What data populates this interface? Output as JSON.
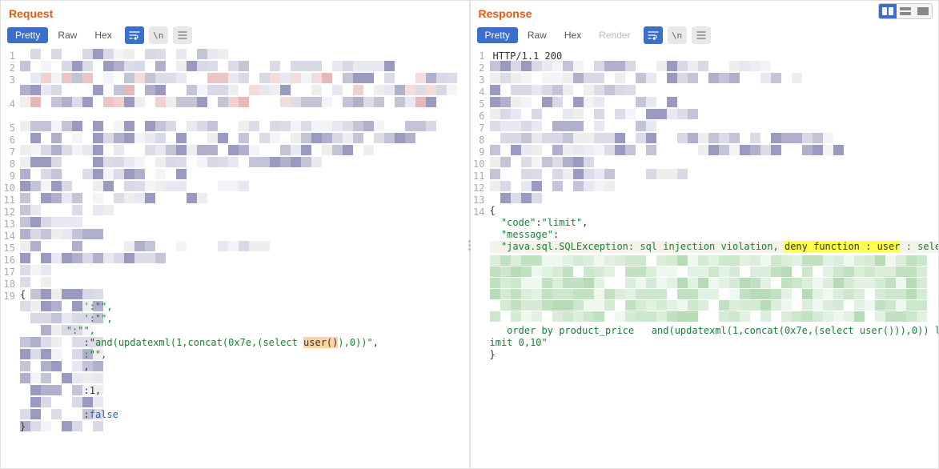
{
  "request": {
    "title": "Request",
    "tabs": {
      "pretty": "Pretty",
      "raw": "Raw",
      "hex": "Hex"
    },
    "icon_wrap": "\\n",
    "line_nums": [
      "1",
      "2",
      "3",
      "",
      "4",
      "",
      "5",
      "6",
      "7",
      "8",
      "9",
      "10",
      "11",
      "12",
      "13",
      "14",
      "15",
      "16",
      "17",
      "18",
      "19"
    ],
    "body_open": "{",
    "field_empty1": "':\"\",",
    "field_empty2": "':\"\",",
    "field_empty3": "\":\"\",",
    "payload_prefix": ":\"",
    "payload_text": "and(updatexml(1,concat(0x7e,(select ",
    "payload_user": "user()",
    "payload_suffix": "),0))\"",
    "payload_close": ",",
    "field_empty4": ":\"\",",
    "trailing_comma": ",",
    "one_line": ":1,",
    "false_line": ":",
    "false_val": "false",
    "body_close": "}"
  },
  "response": {
    "title": "Response",
    "tabs": {
      "pretty": "Pretty",
      "raw": "Raw",
      "hex": "Hex",
      "render": "Render"
    },
    "icon_wrap": "\\n",
    "line_nums": [
      "1",
      "2",
      "3",
      "4",
      "5",
      "6",
      "7",
      "8",
      "9",
      "10",
      "11",
      "12",
      "13",
      "14"
    ],
    "status_line": "HTTP/1.1 200 ",
    "body_open": "{",
    "code_key": "\"code\"",
    "code_val": "\"limit\"",
    "msg_key": "\"message\"",
    "msg_prefix": "\"java.sql.SQLException: sql injection violation, ",
    "msg_deny": "deny function : user",
    "msg_suffix": " : sele",
    "order_by": "   order by product_price   and(updatexml(1,concat(0x7e,(select user())),0)) l",
    "limit_line": "imit 0,10\"",
    "body_close": "}"
  }
}
